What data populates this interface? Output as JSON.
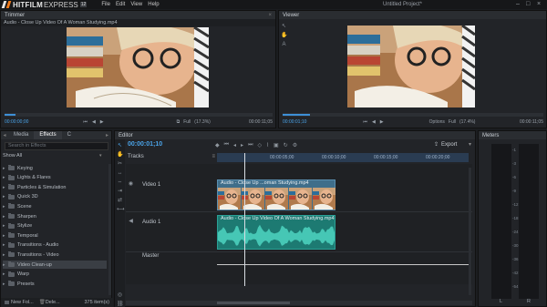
{
  "menubar": {
    "logo_text": "HITFILM",
    "logo_sub": "EXPRESS",
    "logo_ver": "12",
    "menu": [
      "File",
      "Edit",
      "View",
      "Help"
    ],
    "project_title": "Untitled Project*"
  },
  "trimmer": {
    "title": "Trimmer",
    "clip_name": "Audio - Close Up Video Of A Woman Studying.mp4",
    "time_start": "00:00:00;00",
    "time_end": "00:00:11;05",
    "quality": "Full",
    "zoom": "(17.3%)"
  },
  "viewer": {
    "title": "Viewer",
    "time_start": "00:00:01;10",
    "time_end": "00:00:11;05",
    "options": "Options",
    "quality": "Full",
    "zoom": "(17.4%)"
  },
  "effects_panel": {
    "tabs": [
      "Media",
      "Effects",
      "C"
    ],
    "search_placeholder": "Search in Effects",
    "show_all": "Show All",
    "items": [
      {
        "label": "Keying"
      },
      {
        "label": "Lights & Flares"
      },
      {
        "label": "Particles & Simulation"
      },
      {
        "label": "Quick 3D"
      },
      {
        "label": "Scene"
      },
      {
        "label": "Sharpen"
      },
      {
        "label": "Stylize"
      },
      {
        "label": "Temporal"
      },
      {
        "label": "Transitions - Audio"
      },
      {
        "label": "Transitions - Video"
      },
      {
        "label": "Video Clean-up",
        "selected": true
      },
      {
        "label": "Warp"
      },
      {
        "label": "Presets"
      }
    ],
    "footer_new_folder": "New Fol...",
    "footer_delete": "Dele...",
    "footer_count": "375 item(s)"
  },
  "editor": {
    "title": "Editor",
    "timecode": "00:00:01;10",
    "export_label": "Export",
    "tracks_label": "Tracks",
    "ruler_marks": [
      "00:00:05;00",
      "00:00:10;00",
      "00:00:15;00",
      "00:00:20;00"
    ],
    "video_track": "Video 1",
    "audio_track": "Audio 1",
    "master_track": "Master",
    "video_clip_name": "Audio - Close Up ...oman Studying.mp4",
    "audio_clip_name": "Audio - Close Up Video Of A Woman Studying.mp4",
    "playhead_fraction": 0.11
  },
  "meters": {
    "title": "Meters",
    "scale": [
      "-1",
      "-3",
      "-6",
      "-9",
      "-12",
      "-18",
      "-24",
      "-30",
      "-36",
      "-42",
      "-54"
    ],
    "channels": [
      "L",
      "R"
    ]
  },
  "colors": {
    "accent": "#3d8fd6",
    "video_clip": "#3f6e8a",
    "audio_clip": "#1d7a72",
    "logo_orange": "#f07a1a"
  }
}
